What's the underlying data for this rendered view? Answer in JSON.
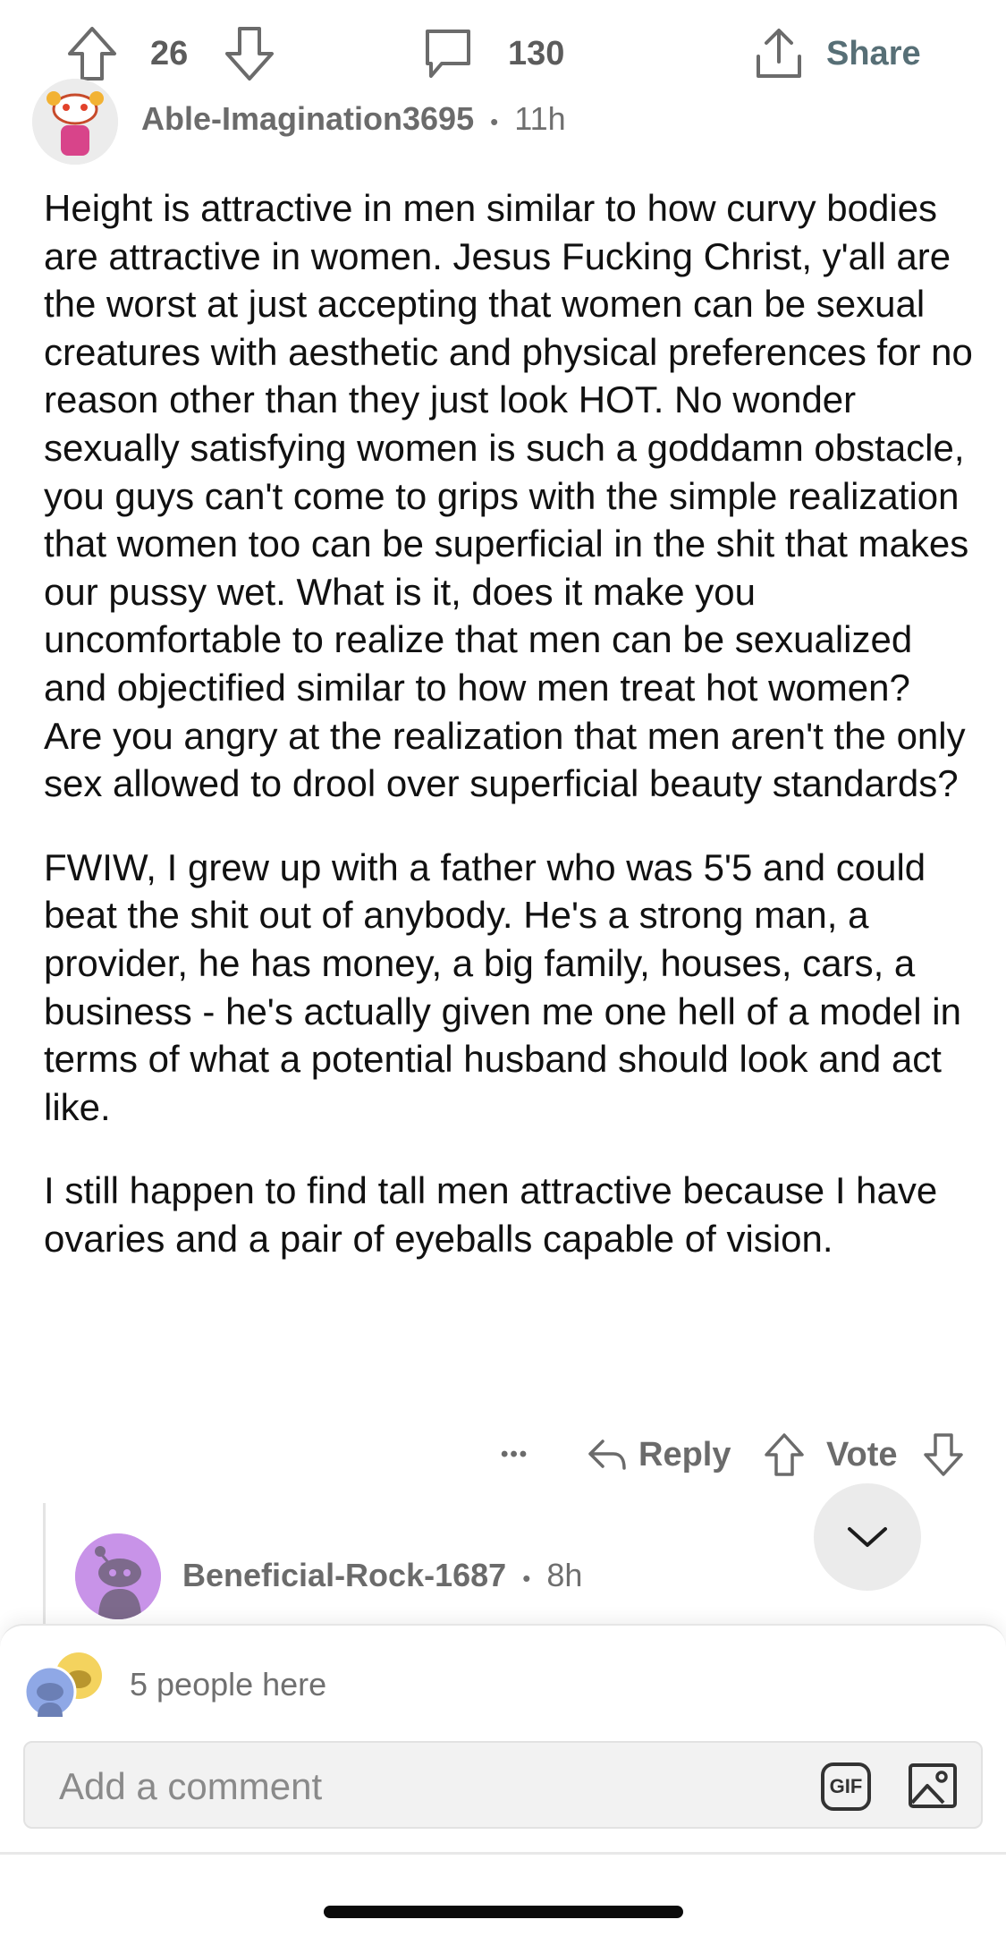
{
  "action_bar": {
    "score": "26",
    "comment_count": "130",
    "share_label": "Share"
  },
  "comment": {
    "author": "Able-Imagination3695",
    "separator": "•",
    "age": "11h",
    "paragraphs": [
      "Height is attractive in men similar to how curvy bodies are attractive in women. Jesus Fucking Christ, y'all are the worst at just accepting that women can be sexual creatures with aesthetic and physical preferences for no reason other than they just look HOT. No wonder sexually satisfying women is such a goddamn obstacle, you guys can't come to grips with the simple realization that women too can be superficial in the shit that makes our pussy wet. What is it, does it make you uncomfortable to realize that men can be sexualized and objectified similar to how men treat hot women? Are you angry at the realization that men aren't the only sex allowed to drool over superficial beauty standards?",
      "FWIW, I grew up with a father who was 5'5 and could beat the shit out of anybody. He's a strong man, a provider, he has money, a big family, houses, cars, a business - he's actually given me one hell of a model in terms of what a potential husband should look and act like.",
      "I still happen to find tall men attractive because I have ovaries and a pair of eyeballs capable of vision."
    ],
    "actions": {
      "more": "•••",
      "reply_label": "Reply",
      "vote_label": "Vote"
    }
  },
  "reply": {
    "author": "Beneficial-Rock-1687",
    "separator": "•",
    "age": "8h"
  },
  "composer": {
    "presence_text": "5 people here",
    "placeholder": "Add a comment",
    "gif_label": "GIF"
  },
  "icons": {
    "upvote": "upvote-arrow-icon",
    "downvote": "downvote-arrow-icon",
    "comment": "comment-bubble-icon",
    "share": "share-icon",
    "reply": "reply-arrow-icon",
    "collapse": "chevron-down-icon",
    "image": "image-icon"
  },
  "colors": {
    "text": "#1c1c1c",
    "muted": "#6b6b6b",
    "reply_avatar_bg": "#c893e8"
  }
}
